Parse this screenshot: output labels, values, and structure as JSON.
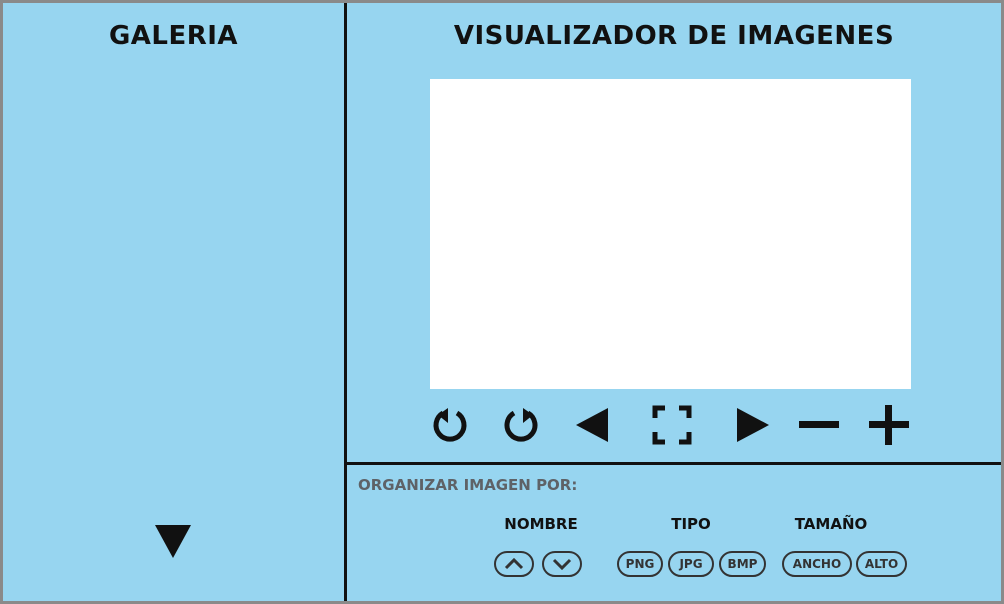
{
  "gallery": {
    "title": "GALERIA",
    "scroll_icon": "triangle-down-icon"
  },
  "viewer": {
    "title": "VISUALIZADOR DE IMAGENES",
    "controls": [
      {
        "name": "rotate-left-icon"
      },
      {
        "name": "rotate-right-icon"
      },
      {
        "name": "previous-icon"
      },
      {
        "name": "fullscreen-icon"
      },
      {
        "name": "next-icon"
      },
      {
        "name": "zoom-out-icon"
      },
      {
        "name": "zoom-in-icon"
      }
    ]
  },
  "organize": {
    "label": "ORGANIZAR IMAGEN POR:",
    "nombre": {
      "label": "NOMBRE",
      "buttons": [
        "chevron-up-icon",
        "chevron-down-icon"
      ]
    },
    "tipo": {
      "label": "TIPO",
      "buttons": [
        "PNG",
        "JPG",
        "BMP"
      ]
    },
    "tamano": {
      "label": "TAMAÑO",
      "buttons": [
        "ANCHO",
        "ALTO"
      ]
    }
  },
  "colors": {
    "background": "#97d5f0",
    "border": "#111111",
    "canvas": "#ffffff",
    "outer_frame": "#8a8a8a",
    "muted_text": "#5e6267"
  }
}
